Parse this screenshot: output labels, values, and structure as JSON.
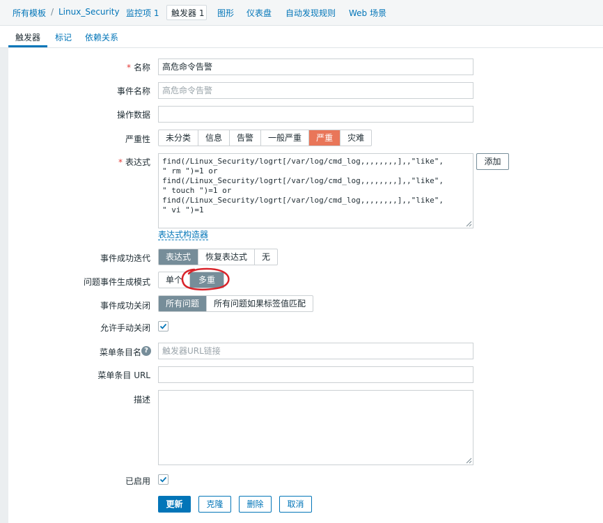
{
  "breadcrumb": {
    "all_templates": "所有模板",
    "separator": "/",
    "host": "Linux_Security",
    "items": "监控项 1",
    "triggers": "触发器 1",
    "graphs": "图形",
    "dashboards": "仪表盘",
    "discovery": "自动发现规则",
    "web": "Web 场景"
  },
  "tabs": {
    "trigger": "触发器",
    "tags": "标记",
    "dependencies": "依赖关系"
  },
  "form": {
    "name": {
      "label": "名称",
      "required_mark": "*",
      "value": "高危命令告警"
    },
    "event_name": {
      "label": "事件名称",
      "placeholder": "高危命令告警"
    },
    "opdata": {
      "label": "操作数据",
      "value": ""
    },
    "severity": {
      "label": "严重性",
      "options": [
        "未分类",
        "信息",
        "告警",
        "一般严重",
        "严重",
        "灾难"
      ],
      "selected": "严重"
    },
    "expression": {
      "label": "表达式",
      "required_mark": "*",
      "value": "find(/Linux_Security/logrt[/var/log/cmd_log,,,,,,,,],,\"like\",\n\" rm \")=1 or\nfind(/Linux_Security/logrt[/var/log/cmd_log,,,,,,,,],,\"like\",\n\" touch \")=1 or\nfind(/Linux_Security/logrt[/var/log/cmd_log,,,,,,,,],,\"like\",\n\" vi \")=1",
      "add_button": "添加",
      "constructor_link": "表达式构造器"
    },
    "ok_event_generation": {
      "label": "事件成功迭代",
      "options": [
        "表达式",
        "恢复表达式",
        "无"
      ],
      "selected": "表达式"
    },
    "problem_mode": {
      "label": "问题事件生成模式",
      "options": [
        "单个",
        "多重"
      ],
      "selected": "多重"
    },
    "ok_closes": {
      "label": "事件成功关闭",
      "options": [
        "所有问题",
        "所有问题如果标签值匹配"
      ],
      "selected": "所有问题"
    },
    "manual_close": {
      "label": "允许手动关闭",
      "checked": true
    },
    "menu_entry_name": {
      "label": "菜单条目名",
      "placeholder": "触发器URL链接",
      "help_icon": "?"
    },
    "menu_entry_url": {
      "label": "菜单条目 URL",
      "value": ""
    },
    "description": {
      "label": "描述",
      "value": ""
    },
    "enabled": {
      "label": "已启用",
      "checked": true
    }
  },
  "buttons": {
    "update": "更新",
    "clone": "克隆",
    "delete": "删除",
    "cancel": "取消"
  },
  "colors": {
    "accent": "#0275b8",
    "severity_high": "#e97659",
    "selected_segment": "#768d99",
    "annotation_circle": "#d9232a"
  }
}
